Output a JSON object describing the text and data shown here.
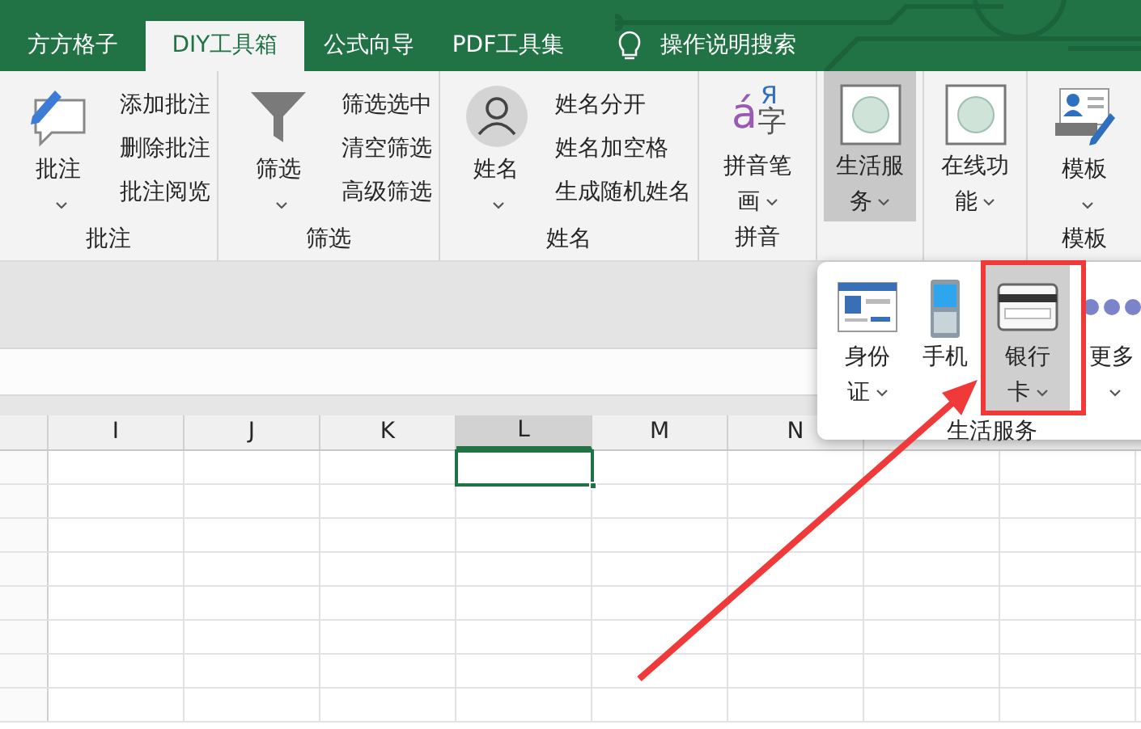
{
  "tabs": [
    {
      "label": "方方格子",
      "selected": false
    },
    {
      "label": "DIY工具箱",
      "selected": true
    },
    {
      "label": "公式向导",
      "selected": false
    },
    {
      "label": "PDF工具集",
      "selected": false
    }
  ],
  "search_hint": {
    "label": "操作说明搜索"
  },
  "ribbon_groups": [
    {
      "label": "批注",
      "large": {
        "label": "批注",
        "dropdown": true,
        "selected": false
      },
      "small": [
        "添加批注",
        "删除批注",
        "批注阅览"
      ]
    },
    {
      "label": "筛选",
      "large": {
        "label": "筛选",
        "dropdown": true,
        "selected": false
      },
      "small": [
        "筛选选中",
        "清空筛选",
        "高级筛选"
      ]
    },
    {
      "label": "姓名",
      "large": {
        "label": "姓名",
        "dropdown": true,
        "selected": false
      },
      "small": [
        "姓名分开",
        "姓名加空格",
        "生成随机姓名"
      ]
    },
    {
      "label": "拼音",
      "large": {
        "label": "拼音笔画",
        "dropdown": true,
        "selected": false,
        "glyphs": [
          "á",
          "Я",
          "字"
        ]
      }
    },
    {
      "large": {
        "label": "生活服务",
        "dropdown": true,
        "selected": true
      }
    },
    {
      "large": {
        "label": "在线功能",
        "dropdown": true,
        "selected": false
      }
    },
    {
      "label": "模板",
      "large": {
        "label": "模板",
        "dropdown": true,
        "selected": false
      }
    }
  ],
  "popup": {
    "label": "生活服务",
    "items": [
      {
        "label": "身份证",
        "dropdown": true,
        "selected": false
      },
      {
        "label": "手机",
        "dropdown": false,
        "selected": false
      },
      {
        "label": "银行卡",
        "dropdown": true,
        "selected": true
      },
      {
        "label": "更多",
        "dropdown": true,
        "selected": false
      }
    ]
  },
  "sheet": {
    "columns": [
      {
        "label": "I",
        "selected": false
      },
      {
        "label": "J",
        "selected": false
      },
      {
        "label": "K",
        "selected": false
      },
      {
        "label": "L",
        "selected": true
      },
      {
        "label": "M",
        "selected": false
      },
      {
        "label": "N",
        "selected": false
      }
    ]
  }
}
